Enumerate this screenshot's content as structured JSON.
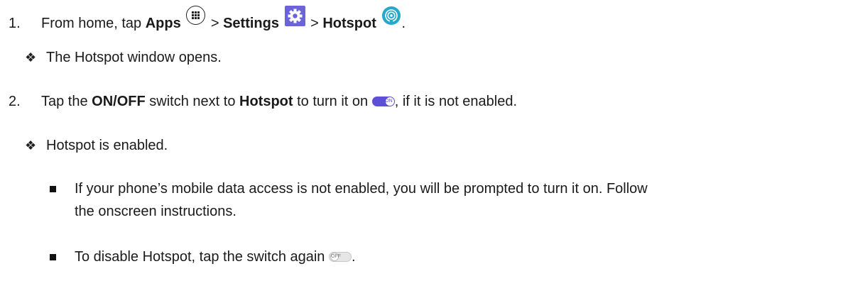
{
  "step1": {
    "number": "1.",
    "text_a": "From home, tap ",
    "apps": "Apps",
    "sep1": " > ",
    "settings": "Settings",
    "sep2": " > ",
    "hotspot": "Hotspot",
    "end": "."
  },
  "result1": {
    "text": "The Hotspot window opens."
  },
  "step2": {
    "number": "2.",
    "text_a": "Tap the ",
    "onoff": "ON/OFF",
    "text_b": " switch next to ",
    "hotspot": "Hotspot",
    "text_c": " to turn it on ",
    "text_d": ", if it is not enabled.",
    "toggle_on_label": "ON"
  },
  "result2": {
    "text": "Hotspot is enabled."
  },
  "bullet1": {
    "line1": "If your phone’s mobile data access is not enabled, you will be prompted to turn it on. Follow",
    "line2": "the onscreen instructions."
  },
  "bullet2": {
    "text": "To disable Hotspot, tap the switch again ",
    "end": ".",
    "toggle_off_label": "OFF"
  },
  "icons": {
    "apps": "apps-grid-icon",
    "settings": "settings-gear-icon",
    "hotspot": "hotspot-icon",
    "toggle_on": "toggle-on-icon",
    "toggle_off": "toggle-off-icon",
    "result_marker": "diamond-bullet-icon",
    "bullet_marker": "square-bullet-icon"
  },
  "colors": {
    "settings_icon": "#6c63d8",
    "hotspot_icon": "#26a9c8",
    "toggle_on": "#5e4fd8"
  }
}
